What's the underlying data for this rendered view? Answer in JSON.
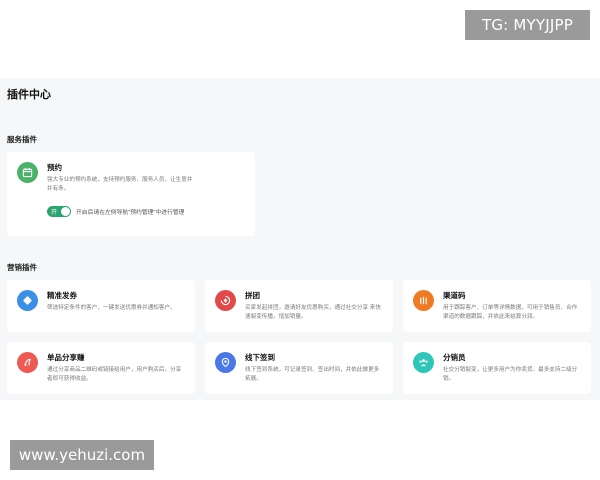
{
  "watermarks": {
    "top": "TG: MYYJJPP",
    "bottom": "www.yehuzi.com"
  },
  "page": {
    "title": "插件中心"
  },
  "service_section": {
    "title": "服务插件",
    "cards": [
      {
        "title": "预约",
        "description": "强大专业的预约系统，支持预约服务、服务人员，让生意井井有条。",
        "icon": "calendar-icon",
        "color": "#4cb26a",
        "toggle_label": "开",
        "toggle_on": true,
        "toggle_text": "开启后请在左侧导航\"预约管理\"中进行管理"
      }
    ]
  },
  "marketing_section": {
    "title": "营销插件",
    "cards": [
      {
        "title": "精准发券",
        "description": "筛选特定条件的客户，一键发送优惠券并通知客户。",
        "icon": "ticket-icon",
        "color": "#3b8fe8"
      },
      {
        "title": "拼团",
        "description": "买家发起拼团，邀请好友优惠购买，通过社交分享 来快速裂变传播，增加销量。",
        "icon": "group-buy-icon",
        "color": "#e24a4a"
      },
      {
        "title": "渠道码",
        "description": "用于跟踪客户、订单等详情数据，可用于销售员、合作渠道的数据跟踪，并依此来结算分润。",
        "icon": "channel-icon",
        "color": "#f07a23"
      },
      {
        "title": "单品分享赚",
        "description": "通过分享商品二维码或链接给用户，用户购买后，分享者即可获得收益。",
        "icon": "share-earn-icon",
        "color": "#ee5a52"
      },
      {
        "title": "线下签到",
        "description": "线下签到系统，可记录签到、签出时间，并依此做更多拓展。",
        "icon": "location-pin-icon",
        "color": "#4a78e8"
      },
      {
        "title": "分销员",
        "description": "社交分销裂变，让更多用户为你卖货。最多支持二级分销。",
        "icon": "distributor-icon",
        "color": "#2ec6b8"
      }
    ]
  }
}
